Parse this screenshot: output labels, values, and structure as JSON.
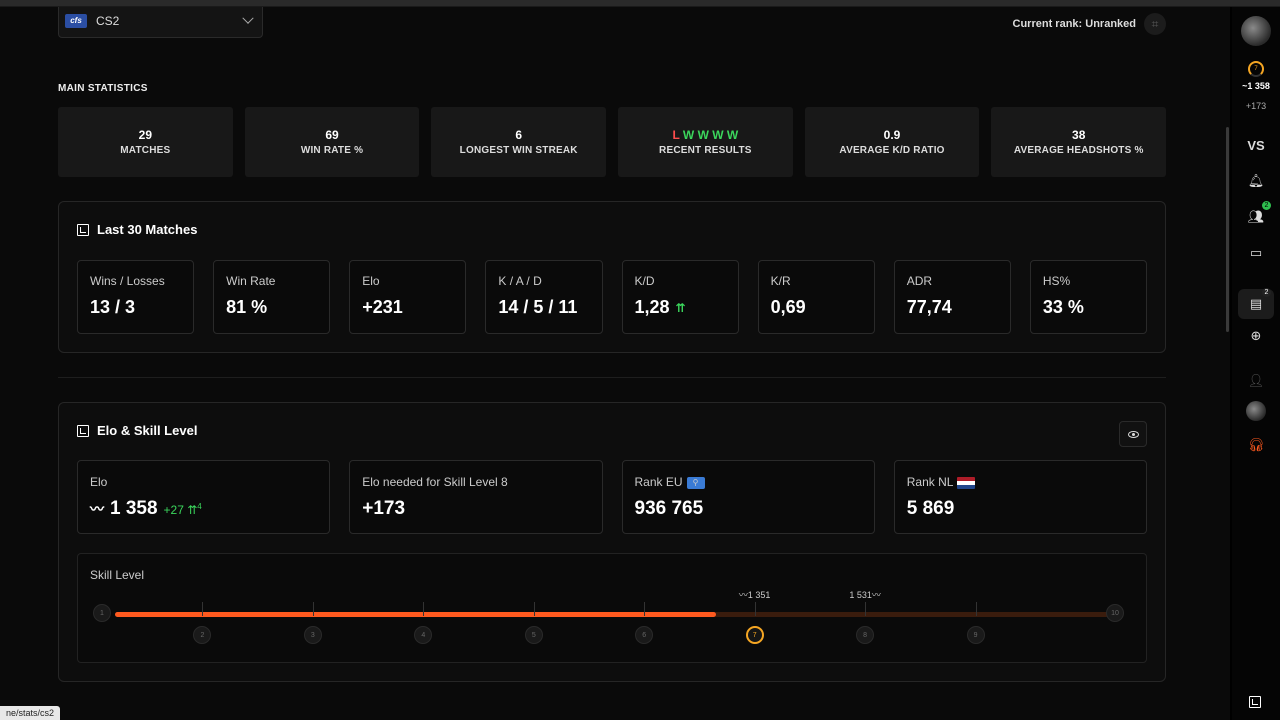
{
  "game": {
    "logo": "cfs",
    "name": "CS2"
  },
  "rank": {
    "label": "Current rank: Unranked"
  },
  "main_stats": {
    "title": "MAIN STATISTICS",
    "cards": [
      {
        "value": "29",
        "label": "MATCHES"
      },
      {
        "value": "69",
        "label": "WIN RATE %"
      },
      {
        "value": "6",
        "label": "LONGEST WIN STREAK"
      },
      {
        "value": "",
        "label": "RECENT RESULTS"
      },
      {
        "value": "0.9",
        "label": "AVERAGE K/D RATIO"
      },
      {
        "value": "38",
        "label": "AVERAGE HEADSHOTS %"
      }
    ],
    "recent_results": [
      "L",
      "W",
      "W",
      "W",
      "W"
    ]
  },
  "last_matches": {
    "title": "Last 30 Matches",
    "cards": [
      {
        "label": "Wins / Losses",
        "value": "13 / 3"
      },
      {
        "label": "Win Rate",
        "value": "81 %"
      },
      {
        "label": "Elo",
        "value": "+231"
      },
      {
        "label": "K / A / D",
        "value": "14 / 5 / 11"
      },
      {
        "label": "K/D",
        "value": "1,28"
      },
      {
        "label": "K/R",
        "value": "0,69"
      },
      {
        "label": "ADR",
        "value": "77,74"
      },
      {
        "label": "HS%",
        "value": "33 %"
      }
    ]
  },
  "elo_section": {
    "title": "Elo & Skill Level",
    "elo": {
      "label": "Elo",
      "value": "1 358",
      "gain": "+27",
      "gain_sup": "4"
    },
    "needed": {
      "label": "Elo needed for Skill Level 8",
      "value": "+173"
    },
    "rank_eu": {
      "label": "Rank EU",
      "value": "936 765"
    },
    "rank_nl": {
      "label": "Rank NL",
      "value": "5 869"
    },
    "skill": {
      "label": "Skill Level",
      "levels": [
        "1",
        "2",
        "3",
        "4",
        "5",
        "6",
        "7",
        "8",
        "9",
        "10"
      ],
      "current_level": 7,
      "progress_fraction": 0.605,
      "mark_low": "1 351",
      "mark_high": "1 531"
    }
  },
  "sidebar": {
    "elo": "~1 358",
    "elo_needed": "+173",
    "vs_label": "VS",
    "friends_badge": "2",
    "party_badge": "2"
  },
  "status_url": "ne/stats/cs2",
  "colors": {
    "accent": "#ff5a1f",
    "win": "#3bd65c",
    "loss": "#ff4d4d",
    "level": "#f5a623"
  }
}
